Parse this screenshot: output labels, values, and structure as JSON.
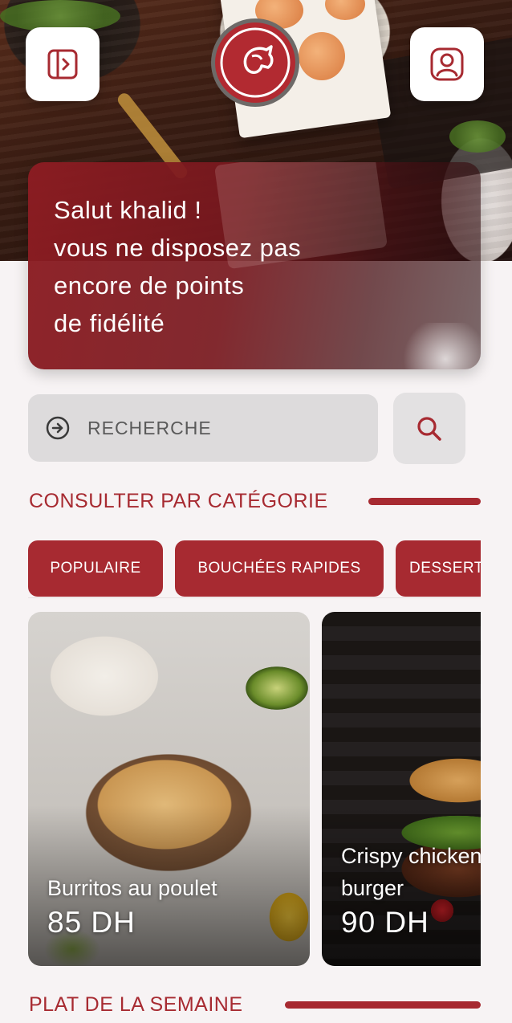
{
  "colors": {
    "brand_red": "#a72a31",
    "white": "#ffffff"
  },
  "header": {
    "menu_icon": "sidebar-toggle-icon",
    "profile_icon": "user-profile-icon",
    "logo": "restaurant-logo"
  },
  "greeting": {
    "lines": [
      "Salut khalid !",
      "vous ne disposez pas",
      "encore de points",
      "de fidélité"
    ]
  },
  "search": {
    "placeholder": "RECHERCHE",
    "leading_icon": "arrow-right-circle-icon",
    "button_icon": "search-icon"
  },
  "categories": {
    "title": "CONSULTER PAR CATÉGORIE",
    "items": [
      "POPULAIRE",
      "BOUCHÉES RAPIDES",
      "DESSERTS"
    ]
  },
  "products": [
    {
      "name": "Burritos au poulet",
      "price": "85 DH"
    },
    {
      "name_lines": [
        "Crispy chicken",
        "burger"
      ],
      "price": "90 DH"
    }
  ],
  "weekly": {
    "title": "PLAT DE LA SEMAINE"
  }
}
